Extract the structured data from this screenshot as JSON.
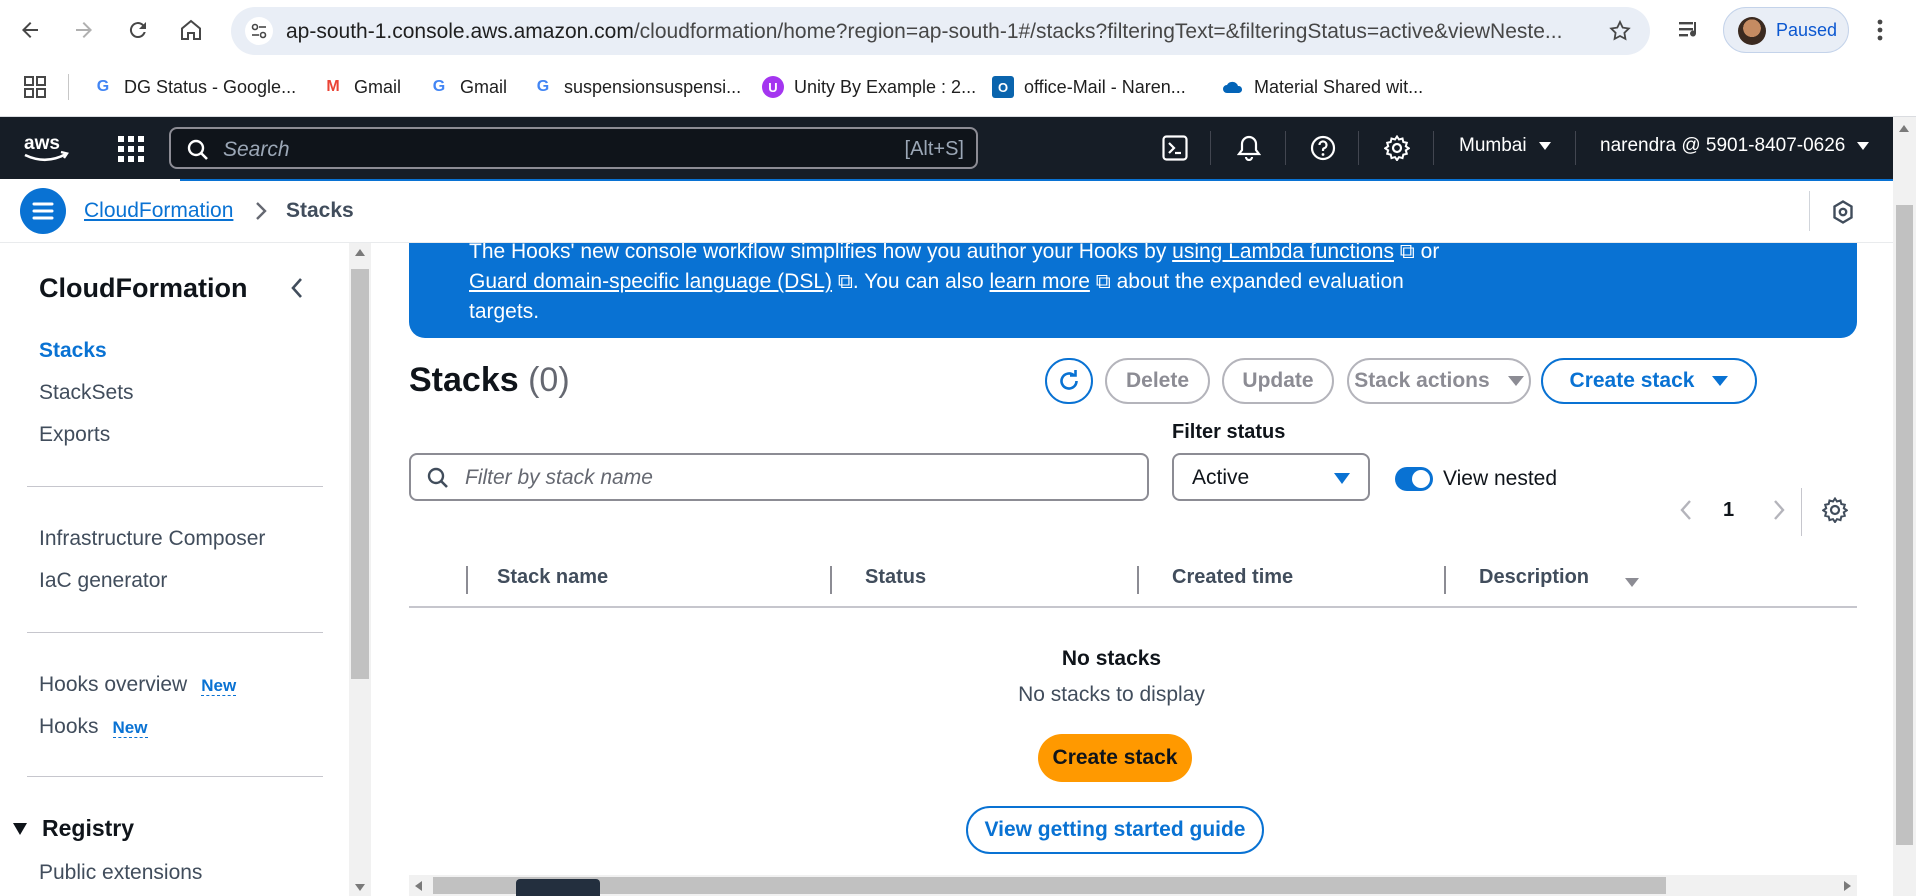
{
  "browser": {
    "url_host": "ap-south-1.console.aws.amazon.com",
    "url_path": "/cloudformation/home?region=ap-south-1#/stacks?filteringText=&filteringStatus=active&viewNeste...",
    "profile_status": "Paused",
    "bookmarks": [
      {
        "label": "DG Status - Google...",
        "icon": "google-icon"
      },
      {
        "label": "Gmail",
        "icon": "gmail-icon"
      },
      {
        "label": "Gmail",
        "icon": "google-icon"
      },
      {
        "label": "suspensionsuspensi...",
        "icon": "google-icon"
      },
      {
        "label": "Unity By Example : 2...",
        "icon": "udemy-icon"
      },
      {
        "label": "office-Mail - Naren...",
        "icon": "outlook-icon"
      },
      {
        "label": "Material Shared wit...",
        "icon": "onedrive-icon"
      }
    ]
  },
  "aws_nav": {
    "search_placeholder": "Search",
    "search_shortcut": "[Alt+S]",
    "region": "Mumbai",
    "account": "narendra @ 5901-8407-0626"
  },
  "breadcrumb": {
    "service": "CloudFormation",
    "current": "Stacks"
  },
  "sidebar": {
    "title": "CloudFormation",
    "items_group1": [
      "Stacks",
      "StackSets",
      "Exports"
    ],
    "items_group2": [
      "Infrastructure Composer",
      "IaC generator"
    ],
    "hooks_overview": "Hooks overview",
    "hooks": "Hooks",
    "new_badge": "New",
    "registry": "Registry",
    "public_extensions": "Public extensions"
  },
  "flash": {
    "line1_pre": "The Hooks' new console workflow simplifies how you author your Hooks by ",
    "link1": "using Lambda functions",
    "line1_post": " or",
    "link2": "Guard domain-specific language (DSL)",
    "mid": ". You can also ",
    "link3": "learn more",
    "tail": " about the expanded evaluation targets."
  },
  "stacks": {
    "title": "Stacks",
    "count": "(0)",
    "buttons": {
      "delete": "Delete",
      "update": "Update",
      "stack_actions": "Stack actions",
      "create_stack": "Create stack"
    },
    "filter_status_label": "Filter status",
    "filter_placeholder": "Filter by stack name",
    "status_value": "Active",
    "view_nested_label": "View nested",
    "view_nested_on": true,
    "page": "1",
    "columns": [
      "Stack name",
      "Status",
      "Created time",
      "Description"
    ],
    "empty_title": "No stacks",
    "empty_subtitle": "No stacks to display",
    "empty_create": "Create stack",
    "empty_guide": "View getting started guide"
  }
}
